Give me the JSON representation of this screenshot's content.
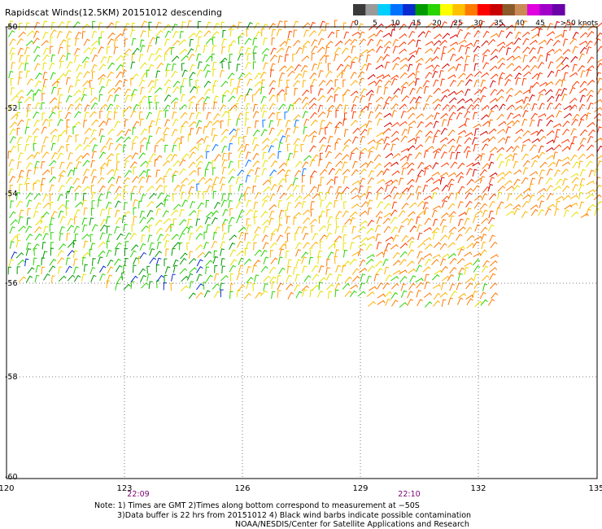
{
  "title": "Rapidscat Winds(12.5KM) 20151012 descending",
  "legend": {
    "labels": [
      "0",
      "5",
      "10",
      "15",
      "20",
      "25",
      "30",
      "35",
      "40",
      "45",
      ">50 knots"
    ],
    "colors": [
      "#3a3a3a",
      "#9a9a9a",
      "#00cfff",
      "#0072ff",
      "#0a2bd0",
      "#009a00",
      "#29d400",
      "#ffff00",
      "#ffc000",
      "#ff7a00",
      "#ff0000",
      "#c80000",
      "#8b5a2b",
      "#c98a55",
      "#e000e0",
      "#a000c8",
      "#6a00a8"
    ]
  },
  "map": {
    "x_ticks": [
      "120",
      "123",
      "126",
      "129",
      "132",
      "135"
    ],
    "y_ticks": [
      "-50",
      "-52",
      "-54",
      "-56",
      "-58",
      "-60"
    ],
    "times": [
      "22:09",
      "22:10"
    ]
  },
  "notes": {
    "line1": "Note: 1) Times are GMT 2)Times along bottom correspond to measurement at −50S",
    "line2": "3)Data buffer is 22 hrs from 20151012 4) Black wind barbs indicate possible contamination",
    "line3": "NOAA/NESDIS/Center for Satellite Applications and Research"
  }
}
